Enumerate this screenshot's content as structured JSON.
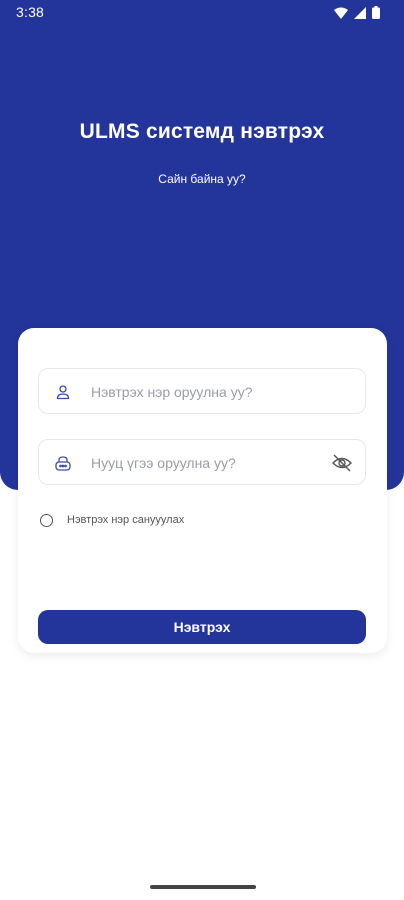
{
  "status_bar": {
    "time": "3:38",
    "icons": [
      "wifi-icon",
      "cellular-icon",
      "battery-icon"
    ]
  },
  "header": {
    "title": "ULMS системд нэвтрэх",
    "subtitle": "Сайн байна уу?"
  },
  "form": {
    "username": {
      "placeholder": "Нэвтрэх нэр оруулна уу?",
      "value": "",
      "icon": "user-icon"
    },
    "password": {
      "placeholder": "Нууц үгээ оруулна уу?",
      "value": "",
      "icon": "lock-icon",
      "toggle_icon": "eye-off-icon"
    },
    "remember_me": {
      "label": "Нэвтрэх нэр санууулах",
      "checked": false
    },
    "submit_label": "Нэвтрэх"
  },
  "colors": {
    "primary": "#23349b",
    "card_background": "#ffffff",
    "field_border": "#e6e7ef",
    "placeholder": "#9a9ca6"
  }
}
